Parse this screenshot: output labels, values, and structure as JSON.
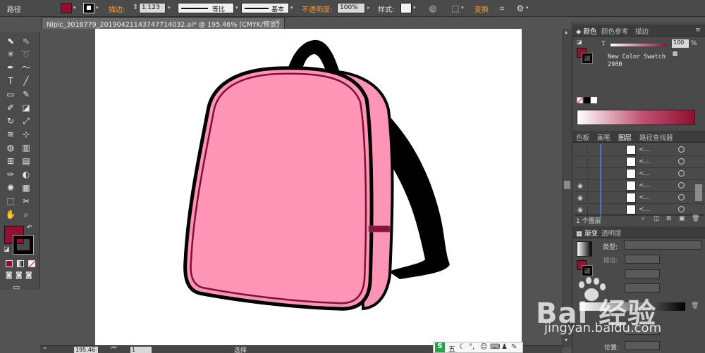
{
  "control_bar": {
    "selection_label": "路径",
    "fill_color": "#8f1030",
    "stroke_label": "描边:",
    "stroke_weight": "1.123",
    "profile_label": "等比",
    "brush_label": "基本",
    "opacity_label": "不透明度:",
    "opacity_value": "100%",
    "style_label": "样式:",
    "transform_link": "变换"
  },
  "document_tab": {
    "title": "Nipic_3018779_20190421143747714032.ai* @ 195.46% (CMYK/预览)",
    "close": "×"
  },
  "tools": [
    "selection-tool",
    "direct-selection-tool",
    "magic-wand-tool",
    "lasso-tool",
    "pen-tool",
    "curvature-tool",
    "type-tool",
    "line-tool",
    "rectangle-tool",
    "paintbrush-tool",
    "pencil-tool",
    "eraser-tool",
    "rotate-tool",
    "scale-tool",
    "width-tool",
    "free-transform-tool",
    "shape-builder-tool",
    "chart-tool",
    "mesh-tool",
    "gradient-tool",
    "eyedropper-tool",
    "blend-tool",
    "symbol-sprayer-tool",
    "graph-tool",
    "artboard-tool",
    "slice-tool",
    "hand-tool",
    "zoom-tool"
  ],
  "toolbox": {
    "fill_color": "#8f1030",
    "stroke_color": "#000000"
  },
  "color_panel": {
    "tabs": [
      "颜色",
      "颜色参考",
      "描边"
    ],
    "tint_label": "T",
    "tint_value": "100",
    "percent": "%",
    "swatch_name": "New Color Swatch",
    "swatch_number": "2980",
    "swatch_color": "#8f1030"
  },
  "layers_panel": {
    "tabs": [
      "色板",
      "画笔",
      "图层",
      "路径查找器"
    ],
    "rows": [
      {
        "label": "<...",
        "visible": false
      },
      {
        "label": "<...",
        "visible": false
      },
      {
        "label": "<...",
        "visible": false
      },
      {
        "label": "<...",
        "visible": true
      },
      {
        "label": "<...",
        "visible": true
      },
      {
        "label": "<...",
        "visible": true
      }
    ],
    "footer": "1 个图层"
  },
  "gradient_panel": {
    "tabs": [
      "渐变",
      "透明度"
    ],
    "type_label": "类型:",
    "stroke_label": "描边:",
    "position_label": "位置:"
  },
  "status_bar": {
    "zoom": "195.46",
    "page": "1",
    "mode": "选择"
  },
  "ime": {
    "brand": "S",
    "mode": "五"
  },
  "watermark": {
    "brand": "Bai  经验",
    "url": "jingyan.baidu.com"
  },
  "colors": {
    "backpack_body": "#fe94b6",
    "backpack_outline": "#000000",
    "backpack_trim": "#7a1238",
    "strap": "#000000",
    "buckle": "#8f1030"
  }
}
